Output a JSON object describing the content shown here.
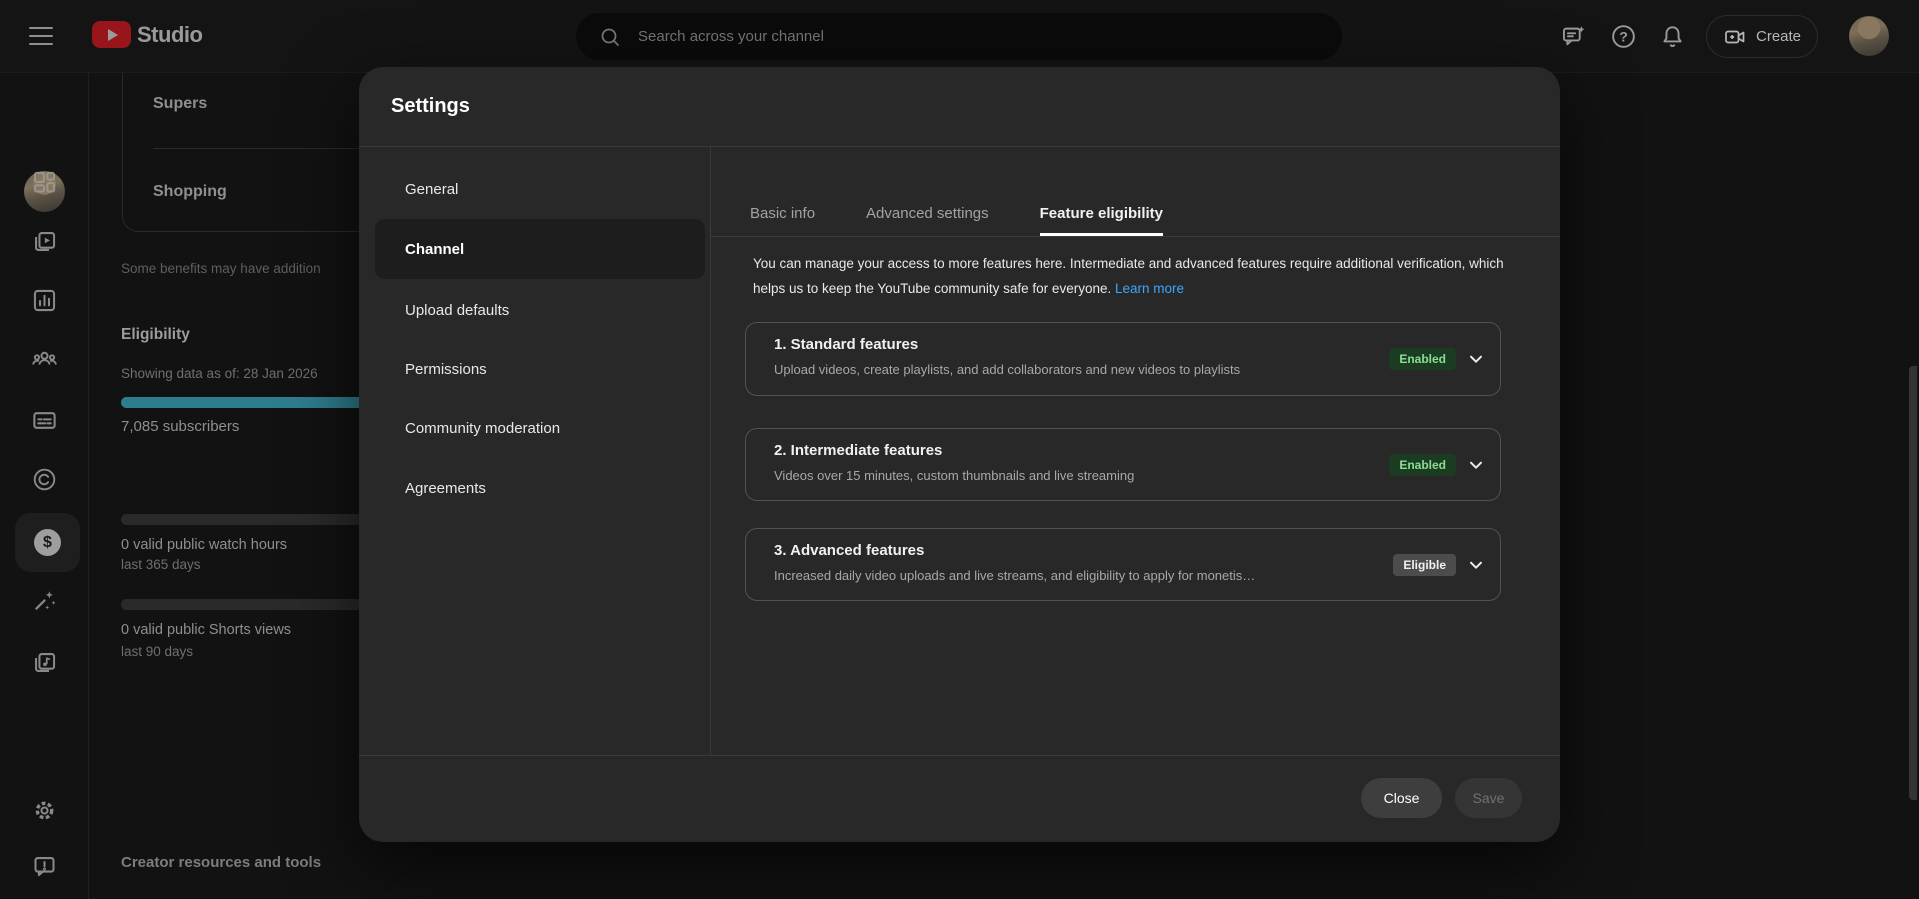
{
  "topbar": {
    "brand": "Studio",
    "search_placeholder": "Search across your channel",
    "create_label": "Create"
  },
  "sidebar": {
    "items": [
      "dashboard",
      "content",
      "analytics",
      "community",
      "subtitles",
      "copyright",
      "earn",
      "customization",
      "audio-library",
      "settings",
      "send-feedback"
    ],
    "selected": "earn"
  },
  "background": {
    "benefit_rows": [
      "Supers",
      "Shopping"
    ],
    "benefits_note": "Some benefits may have addition",
    "eligibility": {
      "title": "Eligibility",
      "as_of": "Showing data as of: 28 Jan 2026",
      "subscribers": "7,085 subscribers",
      "watch_hours": "0 valid public watch hours",
      "watch_hours_period": "last 365 days",
      "shorts_views": "0 valid public Shorts views",
      "shorts_period": "last 90 days"
    },
    "footer_link": "Creator resources and tools"
  },
  "modal": {
    "title": "Settings",
    "nav": [
      "General",
      "Channel",
      "Upload defaults",
      "Permissions",
      "Community moderation",
      "Agreements"
    ],
    "selected_nav": "Channel",
    "tabs": [
      "Basic info",
      "Advanced settings",
      "Feature eligibility"
    ],
    "active_tab": "Feature eligibility",
    "description": "You can manage your access to more features here. Intermediate and advanced features require additional verification, which helps us to keep the YouTube community safe for everyone.",
    "learn_more_label": "Learn more",
    "features": [
      {
        "title": "1. Standard features",
        "desc": "Upload videos, create playlists, and add collaborators and new videos to playlists",
        "badge": "Enabled"
      },
      {
        "title": "2. Intermediate features",
        "desc": "Videos over 15 minutes, custom thumbnails and live streaming",
        "badge": "Enabled"
      },
      {
        "title": "3. Advanced features",
        "desc": "Increased daily video uploads and live streams, and eligibility to apply for monetis…",
        "badge": "Eligible"
      }
    ],
    "close_label": "Close",
    "save_label": "Save"
  },
  "colors": {
    "link_blue": "#3ea6ff",
    "badge_enabled_bg": "#1c3b23",
    "badge_enabled_text": "#8ade92",
    "badge_eligible_bg": "#4c4c4c",
    "badge_eligible_text": "#f1f1f1",
    "progress_teal": "#2e7d8e",
    "modal_bg": "#282828",
    "brand_red": "#98151c"
  }
}
